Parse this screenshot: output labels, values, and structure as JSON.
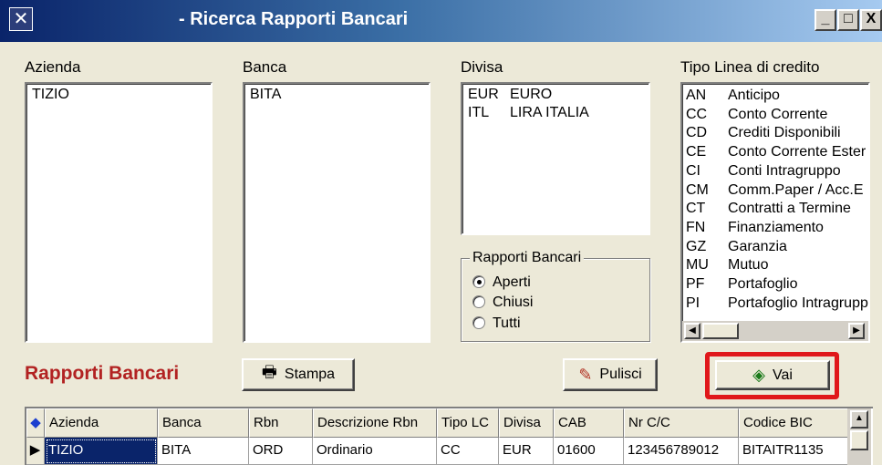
{
  "window": {
    "title": "- Ricerca Rapporti Bancari",
    "icon": "app-icon",
    "controls": {
      "minimize": "_",
      "maximize": "□",
      "close": "X"
    }
  },
  "azienda": {
    "label": "Azienda",
    "items": [
      "TIZIO"
    ]
  },
  "banca": {
    "label": "Banca",
    "items": [
      "BITA"
    ]
  },
  "divisa": {
    "label": "Divisa",
    "items": [
      {
        "code": "EUR",
        "desc": "EURO"
      },
      {
        "code": "ITL",
        "desc": "LIRA ITALIA"
      }
    ]
  },
  "rapporti_bancari_group": {
    "title": "Rapporti Bancari",
    "options": [
      "Aperti",
      "Chiusi",
      "Tutti"
    ],
    "selected": "Aperti"
  },
  "tipo_linea": {
    "label": "Tipo Linea di credito",
    "items": [
      {
        "code": "AN",
        "desc": "Anticipo"
      },
      {
        "code": "CC",
        "desc": "Conto Corrente"
      },
      {
        "code": "CD",
        "desc": "Crediti Disponibili"
      },
      {
        "code": "CE",
        "desc": "Conto Corrente Ester"
      },
      {
        "code": "CI",
        "desc": "Conti Intragruppo"
      },
      {
        "code": "CM",
        "desc": "Comm.Paper / Acc.E"
      },
      {
        "code": "CT",
        "desc": "Contratti a Termine"
      },
      {
        "code": "FN",
        "desc": "Finanziamento"
      },
      {
        "code": "GZ",
        "desc": "Garanzia"
      },
      {
        "code": "MU",
        "desc": "Mutuo"
      },
      {
        "code": "PF",
        "desc": "Portafoglio"
      },
      {
        "code": "PI",
        "desc": "Portafoglio Intragrupp"
      }
    ]
  },
  "section_title": "Rapporti Bancari",
  "buttons": {
    "stampa": "Stampa",
    "pulisci": "Pulisci",
    "vai": "Vai"
  },
  "colors": {
    "section_title": "#b22222",
    "highlight": "#e0181b",
    "selection": "#0a246a"
  },
  "grid": {
    "columns": [
      "Azienda",
      "Banca",
      "Rbn",
      "Descrizione Rbn",
      "Tipo LC",
      "Divisa",
      "CAB",
      "Nr C/C",
      "Codice BIC"
    ],
    "rows": [
      [
        "TIZIO",
        "BITA",
        "ORD",
        "Ordinario",
        "CC",
        "EUR",
        "01600",
        "123456789012",
        "BITAITR1135"
      ]
    ]
  }
}
